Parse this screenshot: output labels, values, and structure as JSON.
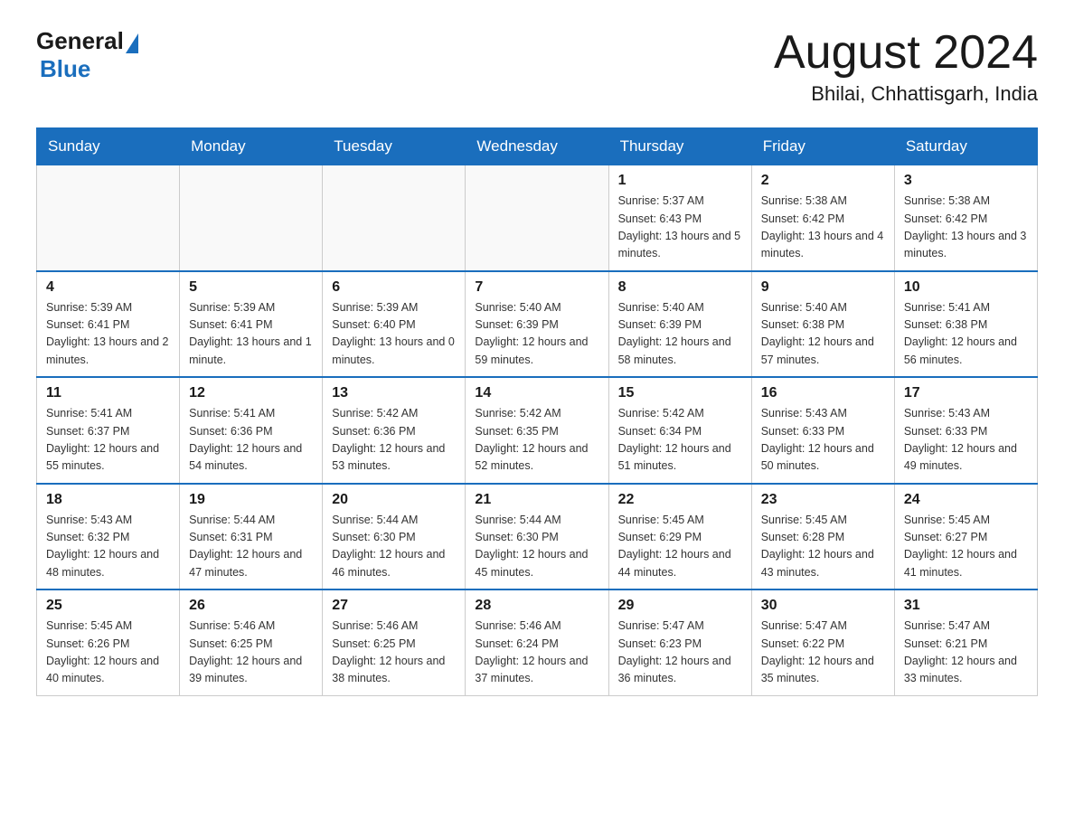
{
  "header": {
    "logo_general": "General",
    "logo_blue": "Blue",
    "month_title": "August 2024",
    "location": "Bhilai, Chhattisgarh, India"
  },
  "days_of_week": [
    "Sunday",
    "Monday",
    "Tuesday",
    "Wednesday",
    "Thursday",
    "Friday",
    "Saturday"
  ],
  "weeks": [
    [
      {
        "day": "",
        "info": ""
      },
      {
        "day": "",
        "info": ""
      },
      {
        "day": "",
        "info": ""
      },
      {
        "day": "",
        "info": ""
      },
      {
        "day": "1",
        "info": "Sunrise: 5:37 AM\nSunset: 6:43 PM\nDaylight: 13 hours and 5 minutes."
      },
      {
        "day": "2",
        "info": "Sunrise: 5:38 AM\nSunset: 6:42 PM\nDaylight: 13 hours and 4 minutes."
      },
      {
        "day": "3",
        "info": "Sunrise: 5:38 AM\nSunset: 6:42 PM\nDaylight: 13 hours and 3 minutes."
      }
    ],
    [
      {
        "day": "4",
        "info": "Sunrise: 5:39 AM\nSunset: 6:41 PM\nDaylight: 13 hours and 2 minutes."
      },
      {
        "day": "5",
        "info": "Sunrise: 5:39 AM\nSunset: 6:41 PM\nDaylight: 13 hours and 1 minute."
      },
      {
        "day": "6",
        "info": "Sunrise: 5:39 AM\nSunset: 6:40 PM\nDaylight: 13 hours and 0 minutes."
      },
      {
        "day": "7",
        "info": "Sunrise: 5:40 AM\nSunset: 6:39 PM\nDaylight: 12 hours and 59 minutes."
      },
      {
        "day": "8",
        "info": "Sunrise: 5:40 AM\nSunset: 6:39 PM\nDaylight: 12 hours and 58 minutes."
      },
      {
        "day": "9",
        "info": "Sunrise: 5:40 AM\nSunset: 6:38 PM\nDaylight: 12 hours and 57 minutes."
      },
      {
        "day": "10",
        "info": "Sunrise: 5:41 AM\nSunset: 6:38 PM\nDaylight: 12 hours and 56 minutes."
      }
    ],
    [
      {
        "day": "11",
        "info": "Sunrise: 5:41 AM\nSunset: 6:37 PM\nDaylight: 12 hours and 55 minutes."
      },
      {
        "day": "12",
        "info": "Sunrise: 5:41 AM\nSunset: 6:36 PM\nDaylight: 12 hours and 54 minutes."
      },
      {
        "day": "13",
        "info": "Sunrise: 5:42 AM\nSunset: 6:36 PM\nDaylight: 12 hours and 53 minutes."
      },
      {
        "day": "14",
        "info": "Sunrise: 5:42 AM\nSunset: 6:35 PM\nDaylight: 12 hours and 52 minutes."
      },
      {
        "day": "15",
        "info": "Sunrise: 5:42 AM\nSunset: 6:34 PM\nDaylight: 12 hours and 51 minutes."
      },
      {
        "day": "16",
        "info": "Sunrise: 5:43 AM\nSunset: 6:33 PM\nDaylight: 12 hours and 50 minutes."
      },
      {
        "day": "17",
        "info": "Sunrise: 5:43 AM\nSunset: 6:33 PM\nDaylight: 12 hours and 49 minutes."
      }
    ],
    [
      {
        "day": "18",
        "info": "Sunrise: 5:43 AM\nSunset: 6:32 PM\nDaylight: 12 hours and 48 minutes."
      },
      {
        "day": "19",
        "info": "Sunrise: 5:44 AM\nSunset: 6:31 PM\nDaylight: 12 hours and 47 minutes."
      },
      {
        "day": "20",
        "info": "Sunrise: 5:44 AM\nSunset: 6:30 PM\nDaylight: 12 hours and 46 minutes."
      },
      {
        "day": "21",
        "info": "Sunrise: 5:44 AM\nSunset: 6:30 PM\nDaylight: 12 hours and 45 minutes."
      },
      {
        "day": "22",
        "info": "Sunrise: 5:45 AM\nSunset: 6:29 PM\nDaylight: 12 hours and 44 minutes."
      },
      {
        "day": "23",
        "info": "Sunrise: 5:45 AM\nSunset: 6:28 PM\nDaylight: 12 hours and 43 minutes."
      },
      {
        "day": "24",
        "info": "Sunrise: 5:45 AM\nSunset: 6:27 PM\nDaylight: 12 hours and 41 minutes."
      }
    ],
    [
      {
        "day": "25",
        "info": "Sunrise: 5:45 AM\nSunset: 6:26 PM\nDaylight: 12 hours and 40 minutes."
      },
      {
        "day": "26",
        "info": "Sunrise: 5:46 AM\nSunset: 6:25 PM\nDaylight: 12 hours and 39 minutes."
      },
      {
        "day": "27",
        "info": "Sunrise: 5:46 AM\nSunset: 6:25 PM\nDaylight: 12 hours and 38 minutes."
      },
      {
        "day": "28",
        "info": "Sunrise: 5:46 AM\nSunset: 6:24 PM\nDaylight: 12 hours and 37 minutes."
      },
      {
        "day": "29",
        "info": "Sunrise: 5:47 AM\nSunset: 6:23 PM\nDaylight: 12 hours and 36 minutes."
      },
      {
        "day": "30",
        "info": "Sunrise: 5:47 AM\nSunset: 6:22 PM\nDaylight: 12 hours and 35 minutes."
      },
      {
        "day": "31",
        "info": "Sunrise: 5:47 AM\nSunset: 6:21 PM\nDaylight: 12 hours and 33 minutes."
      }
    ]
  ]
}
